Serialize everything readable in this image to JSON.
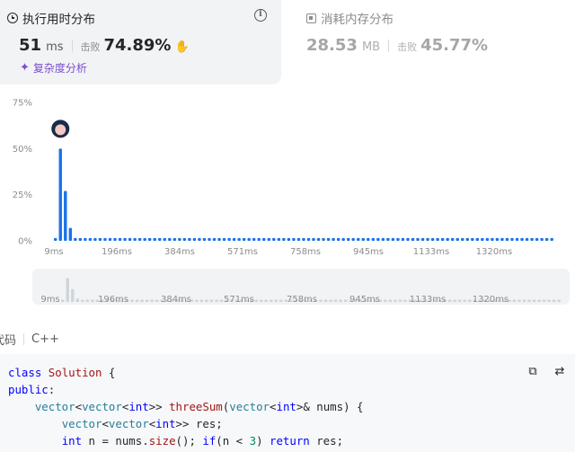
{
  "runtime": {
    "title": "执行用时分布",
    "value": "51",
    "unit": "ms",
    "beats_label": "击败",
    "beats_value": "74.89%",
    "analysis_label": "复杂度分析",
    "icon": "clock-icon"
  },
  "memory": {
    "title": "消耗内存分布",
    "value": "28.53",
    "unit": "MB",
    "beats_label": "击败",
    "beats_value": "45.77%",
    "icon": "chip-icon"
  },
  "colors": {
    "bar": "#1a73e8",
    "bar_muted": "#ced4de",
    "accent_purple": "#7b4ed1",
    "beats_green": "#2db55d"
  },
  "chart_data": [
    {
      "type": "bar",
      "title": "",
      "y_ticks": [
        "75%",
        "50%",
        "25%",
        "0%"
      ],
      "ylim": [
        0,
        75
      ],
      "x_ticks": [
        "9ms",
        "196ms",
        "384ms",
        "571ms",
        "758ms",
        "945ms",
        "1133ms",
        "1320ms"
      ],
      "values": [
        1.5,
        50,
        27,
        7,
        1.5,
        1.5,
        1.5,
        1.5,
        1.5,
        1.5,
        1.5,
        1.5,
        1.5,
        1.5,
        1.5,
        1.5,
        1.5,
        1.5,
        1.5,
        1.5,
        1.5,
        1.5,
        1.5,
        1.5,
        1.5,
        1.5,
        1.5,
        1.5,
        1.5,
        1.5,
        1.5,
        1.5,
        1.5,
        1.5,
        1.5,
        1.5,
        1.5,
        1.5,
        1.5,
        1.5,
        1.5,
        1.5,
        1.5,
        1.5,
        1.5,
        1.5,
        1.5,
        1.5,
        1.5,
        1.5,
        1.5,
        1.5,
        1.5,
        1.5,
        1.5,
        1.5,
        1.5,
        1.5,
        1.5,
        1.5,
        1.5,
        1.5,
        1.5,
        1.5,
        1.5,
        1.5,
        1.5,
        1.5,
        1.5,
        1.5,
        1.5,
        1.5,
        1.5,
        1.5,
        1.5,
        1.5,
        1.5,
        1.5,
        1.5,
        1.5,
        1.5,
        1.5,
        1.5,
        1.5,
        1.5,
        1.5,
        1.5,
        1.5,
        1.5,
        1.5,
        1.5,
        1.5,
        1.5,
        1.5,
        1.5,
        1.5,
        1.5,
        1.5,
        1.5,
        1.5,
        1.5
      ],
      "highlight_index": 1,
      "grid": false
    },
    {
      "type": "bar",
      "title": "",
      "role": "range-selector overview",
      "x_ticks": [
        "9ms",
        "196ms",
        "384ms",
        "571ms",
        "758ms",
        "945ms",
        "1133ms",
        "1320ms"
      ],
      "values": [
        1.5,
        50,
        27,
        7,
        1.5,
        1.5,
        1.5,
        1.5,
        1.5,
        1.5,
        1.5,
        1.5,
        1.5,
        1.5,
        1.5,
        1.5,
        1.5,
        1.5,
        1.5,
        1.5,
        1.5,
        1.5,
        1.5,
        1.5,
        1.5,
        1.5,
        1.5,
        1.5,
        1.5,
        1.5,
        1.5,
        1.5,
        1.5,
        1.5,
        1.5,
        1.5,
        1.5,
        1.5,
        1.5,
        1.5,
        1.5,
        1.5,
        1.5,
        1.5,
        1.5,
        1.5,
        1.5,
        1.5,
        1.5,
        1.5,
        1.5,
        1.5,
        1.5,
        1.5,
        1.5,
        1.5,
        1.5,
        1.5,
        1.5,
        1.5,
        1.5,
        1.5,
        1.5,
        1.5,
        1.5,
        1.5,
        1.5,
        1.5,
        1.5,
        1.5,
        1.5,
        1.5,
        1.5,
        1.5,
        1.5,
        1.5,
        1.5,
        1.5,
        1.5,
        1.5,
        1.5,
        1.5,
        1.5,
        1.5,
        1.5,
        1.5,
        1.5,
        1.5,
        1.5,
        1.5,
        1.5,
        1.5,
        1.5,
        1.5,
        1.5,
        1.5,
        1.5,
        1.5,
        1.5,
        1.5,
        1.5
      ]
    }
  ],
  "code": {
    "label": "代码",
    "language": "C++",
    "copy_icon": "copy-icon",
    "reset_icon": "swap-icon"
  }
}
